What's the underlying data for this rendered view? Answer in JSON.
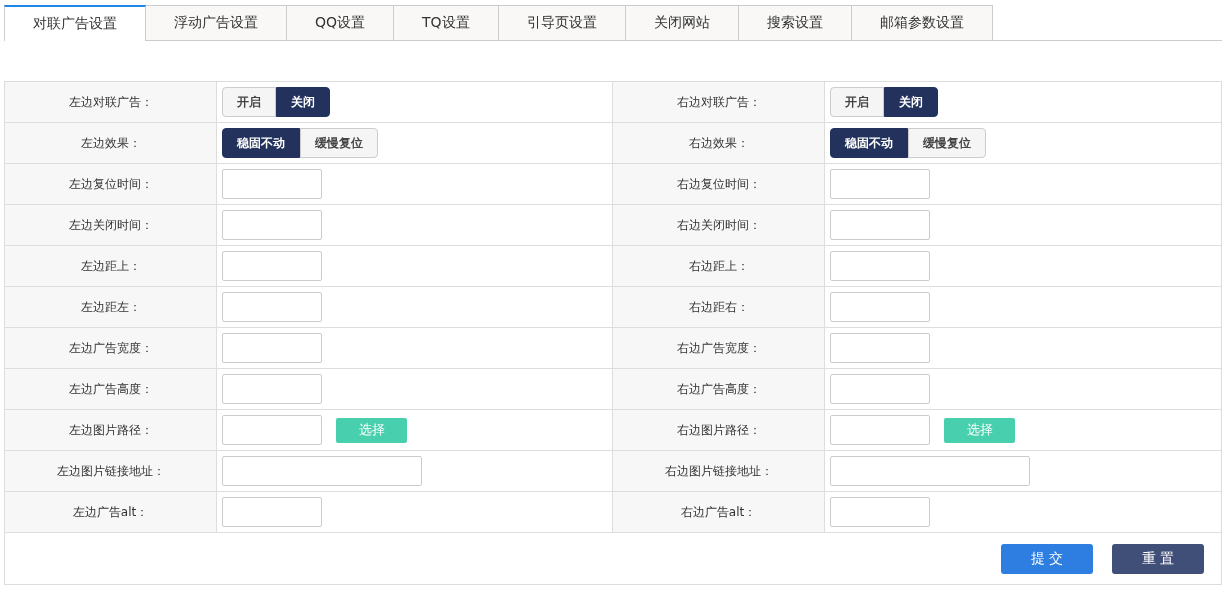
{
  "tabs": [
    {
      "label": "对联广告设置",
      "selected": true
    },
    {
      "label": "浮动广告设置",
      "selected": false
    },
    {
      "label": "QQ设置",
      "selected": false
    },
    {
      "label": "TQ设置",
      "selected": false
    },
    {
      "label": "引导页设置",
      "selected": false
    },
    {
      "label": "关闭网站",
      "selected": false
    },
    {
      "label": "搜索设置",
      "selected": false
    },
    {
      "label": "邮箱参数设置",
      "selected": false
    }
  ],
  "rows": [
    {
      "left": {
        "label": "左边对联广告：",
        "kind": "toggle",
        "options": [
          {
            "label": "开启",
            "selected": false
          },
          {
            "label": "关闭",
            "selected": true
          }
        ]
      },
      "right": {
        "label": "右边对联广告：",
        "kind": "toggle",
        "options": [
          {
            "label": "开启",
            "selected": false
          },
          {
            "label": "关闭",
            "selected": true
          }
        ]
      }
    },
    {
      "left": {
        "label": "左边效果：",
        "kind": "toggle",
        "options": [
          {
            "label": "稳固不动",
            "selected": true
          },
          {
            "label": "缓慢复位",
            "selected": false
          }
        ]
      },
      "right": {
        "label": "右边效果：",
        "kind": "toggle",
        "options": [
          {
            "label": "稳固不动",
            "selected": true
          },
          {
            "label": "缓慢复位",
            "selected": false
          }
        ]
      }
    },
    {
      "left": {
        "label": "左边复位时间：",
        "kind": "input"
      },
      "right": {
        "label": "右边复位时间：",
        "kind": "input"
      }
    },
    {
      "left": {
        "label": "左边关闭时间：",
        "kind": "input"
      },
      "right": {
        "label": "右边关闭时间：",
        "kind": "input"
      }
    },
    {
      "left": {
        "label": "左边距上：",
        "kind": "input"
      },
      "right": {
        "label": "右边距上：",
        "kind": "input"
      }
    },
    {
      "left": {
        "label": "左边距左：",
        "kind": "input"
      },
      "right": {
        "label": "右边距右：",
        "kind": "input"
      }
    },
    {
      "left": {
        "label": "左边广告宽度：",
        "kind": "input"
      },
      "right": {
        "label": "右边广告宽度：",
        "kind": "input"
      }
    },
    {
      "left": {
        "label": "左边广告高度：",
        "kind": "input"
      },
      "right": {
        "label": "右边广告高度：",
        "kind": "input"
      }
    },
    {
      "left": {
        "label": "左边图片路径：",
        "kind": "file",
        "button": "选择"
      },
      "right": {
        "label": "右边图片路径：",
        "kind": "file",
        "button": "选择"
      }
    },
    {
      "left": {
        "label": "左边图片链接地址：",
        "kind": "wide_input"
      },
      "right": {
        "label": "右边图片链接地址：",
        "kind": "wide_input"
      }
    },
    {
      "left": {
        "label": "左边广告alt：",
        "kind": "input"
      },
      "right": {
        "label": "右边广告alt：",
        "kind": "input"
      }
    }
  ],
  "actions": [
    {
      "label": "提 交",
      "kind": "submit"
    },
    {
      "label": "重 置",
      "kind": "reset"
    }
  ]
}
